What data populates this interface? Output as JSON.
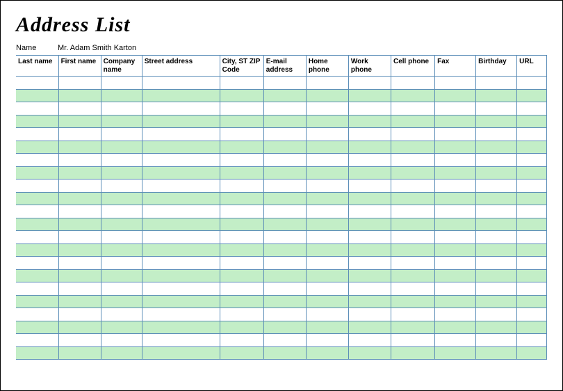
{
  "title": "Address List",
  "nameLabel": "Name",
  "nameValue": "Mr. Adam Smith Karton",
  "columns": [
    "Last name",
    "First name",
    "Company name",
    "Street address",
    "City, ST  ZIP Code",
    "E-mail address",
    "Home phone",
    "Work phone",
    "Cell phone",
    "Fax",
    "Birthday",
    "URL"
  ],
  "rowCount": 22,
  "rows": [
    [
      "",
      "",
      "",
      "",
      "",
      "",
      "",
      "",
      "",
      "",
      "",
      ""
    ],
    [
      "",
      "",
      "",
      "",
      "",
      "",
      "",
      "",
      "",
      "",
      "",
      ""
    ],
    [
      "",
      "",
      "",
      "",
      "",
      "",
      "",
      "",
      "",
      "",
      "",
      ""
    ],
    [
      "",
      "",
      "",
      "",
      "",
      "",
      "",
      "",
      "",
      "",
      "",
      ""
    ],
    [
      "",
      "",
      "",
      "",
      "",
      "",
      "",
      "",
      "",
      "",
      "",
      ""
    ],
    [
      "",
      "",
      "",
      "",
      "",
      "",
      "",
      "",
      "",
      "",
      "",
      ""
    ],
    [
      "",
      "",
      "",
      "",
      "",
      "",
      "",
      "",
      "",
      "",
      "",
      ""
    ],
    [
      "",
      "",
      "",
      "",
      "",
      "",
      "",
      "",
      "",
      "",
      "",
      ""
    ],
    [
      "",
      "",
      "",
      "",
      "",
      "",
      "",
      "",
      "",
      "",
      "",
      ""
    ],
    [
      "",
      "",
      "",
      "",
      "",
      "",
      "",
      "",
      "",
      "",
      "",
      ""
    ],
    [
      "",
      "",
      "",
      "",
      "",
      "",
      "",
      "",
      "",
      "",
      "",
      ""
    ],
    [
      "",
      "",
      "",
      "",
      "",
      "",
      "",
      "",
      "",
      "",
      "",
      ""
    ],
    [
      "",
      "",
      "",
      "",
      "",
      "",
      "",
      "",
      "",
      "",
      "",
      ""
    ],
    [
      "",
      "",
      "",
      "",
      "",
      "",
      "",
      "",
      "",
      "",
      "",
      ""
    ],
    [
      "",
      "",
      "",
      "",
      "",
      "",
      "",
      "",
      "",
      "",
      "",
      ""
    ],
    [
      "",
      "",
      "",
      "",
      "",
      "",
      "",
      "",
      "",
      "",
      "",
      ""
    ],
    [
      "",
      "",
      "",
      "",
      "",
      "",
      "",
      "",
      "",
      "",
      "",
      ""
    ],
    [
      "",
      "",
      "",
      "",
      "",
      "",
      "",
      "",
      "",
      "",
      "",
      ""
    ],
    [
      "",
      "",
      "",
      "",
      "",
      "",
      "",
      "",
      "",
      "",
      "",
      ""
    ],
    [
      "",
      "",
      "",
      "",
      "",
      "",
      "",
      "",
      "",
      "",
      "",
      ""
    ],
    [
      "",
      "",
      "",
      "",
      "",
      "",
      "",
      "",
      "",
      "",
      "",
      ""
    ],
    [
      "",
      "",
      "",
      "",
      "",
      "",
      "",
      "",
      "",
      "",
      "",
      ""
    ]
  ]
}
